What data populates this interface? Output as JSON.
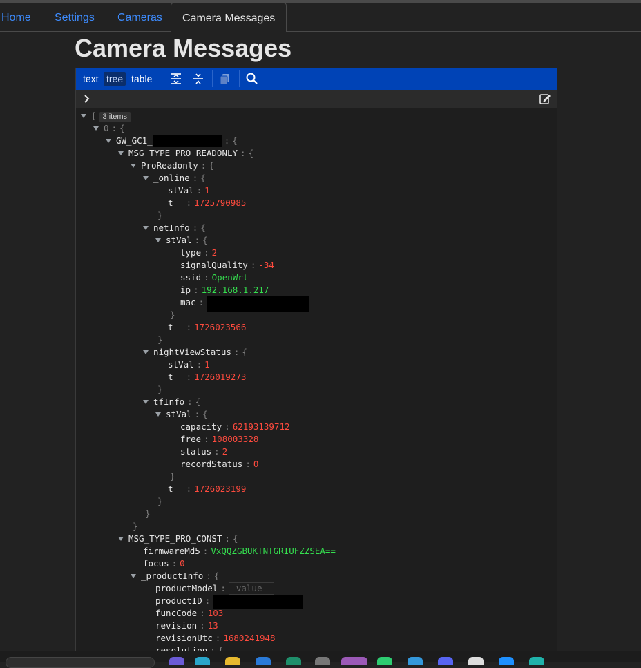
{
  "nav": {
    "tabs": [
      {
        "label": "Home"
      },
      {
        "label": "Settings"
      },
      {
        "label": "Cameras"
      },
      {
        "label": "Camera Messages",
        "active": true
      }
    ]
  },
  "page": {
    "title": "Camera Messages"
  },
  "editor": {
    "modes": [
      "text",
      "tree",
      "table"
    ],
    "active_mode": "tree",
    "tools": [
      "expand-all-icon",
      "collapse-all-icon",
      "copy-icon",
      "search-icon"
    ],
    "root_badge": "3 items",
    "accent": "#0043b6",
    "number_color": "#ff4b3e",
    "string_color": "#35e04f"
  },
  "tree": {
    "root_bracket": "[",
    "item0_key": "0",
    "gw_key": "GW_GC1_",
    "readonly_key": "MSG_TYPE_PRO_READONLY",
    "proreadonly_key": "ProReadonly",
    "online_key": "_online",
    "online_stval_key": "stVal",
    "online_stval": "1",
    "online_t_key": "t",
    "online_t": "1725790985",
    "netinfo_key": "netInfo",
    "netinfo_stval_key": "stVal",
    "type_key": "type",
    "type_val": "2",
    "signal_key": "signalQuality",
    "signal_val": "-34",
    "ssid_key": "ssid",
    "ssid_val": "OpenWrt",
    "ip_key": "ip",
    "ip_val": "192.168.1.217",
    "mac_key": "mac",
    "netinfo_t_key": "t",
    "netinfo_t": "1726023566",
    "night_key": "nightViewStatus",
    "night_stval_key": "stVal",
    "night_stval": "1",
    "night_t_key": "t",
    "night_t": "1726019273",
    "tf_key": "tfInfo",
    "tf_stval_key": "stVal",
    "capacity_key": "capacity",
    "capacity_val": "62193139712",
    "free_key": "free",
    "free_val": "108003328",
    "status_key": "status",
    "status_val": "2",
    "record_key": "recordStatus",
    "record_val": "0",
    "tf_t_key": "t",
    "tf_t": "1726023199",
    "const_key": "MSG_TYPE_PRO_CONST",
    "fw_key": "firmwareMd5",
    "fw_val": "VxQQZGBUKTNTGRIUFZZSEA==",
    "focus_key": "focus",
    "focus_val": "0",
    "product_key": "_productInfo",
    "model_key": "productModel",
    "model_placeholder": "value",
    "pid_key": "productID",
    "func_key": "funcCode",
    "func_val": "103",
    "rev_key": "revision",
    "rev_val": "13",
    "revutc_key": "revisionUtc",
    "revutc_val": "1680241948",
    "res_key": "resolution"
  }
}
